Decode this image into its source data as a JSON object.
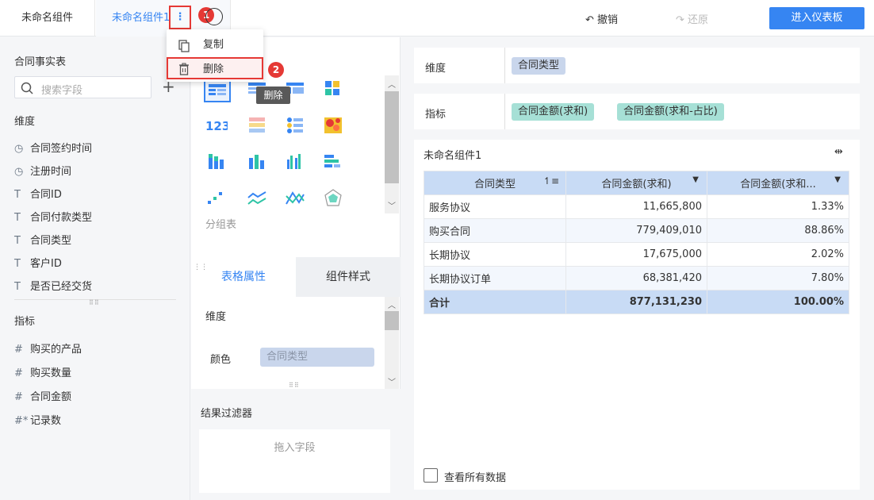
{
  "tabs": [
    {
      "label": "未命名组件"
    },
    {
      "label": "未命名组件1"
    }
  ],
  "header": {
    "undo": "撤销",
    "redo": "还原",
    "enter_dashboard": "进入仪表板"
  },
  "badges": [
    "1",
    "2"
  ],
  "menu": {
    "copy": "复制",
    "delete": "删除"
  },
  "tooltip": "删除",
  "left": {
    "table_name": "合同事实表",
    "search_placeholder": "搜索字段",
    "dimension_title": "维度",
    "dimensions": [
      {
        "icon": "clock-icon",
        "label": "合同签约时间"
      },
      {
        "icon": "clock-icon",
        "label": "注册时间"
      },
      {
        "icon": "text-icon",
        "label": "合同ID"
      },
      {
        "icon": "text-icon",
        "label": "合同付款类型"
      },
      {
        "icon": "text-icon",
        "label": "合同类型"
      },
      {
        "icon": "text-icon",
        "label": "客户ID"
      },
      {
        "icon": "text-icon",
        "label": "是否已经交货"
      }
    ],
    "measure_title": "指标",
    "measures": [
      {
        "icon": "hash-icon",
        "label": "购买的产品"
      },
      {
        "icon": "hash-icon",
        "label": "购买数量"
      },
      {
        "icon": "hash-icon",
        "label": "合同金额"
      },
      {
        "icon": "hash-star-icon",
        "label": "记录数"
      }
    ]
  },
  "middle": {
    "chart_group_label": "分组表",
    "tab_table_props": "表格属性",
    "tab_widget_style": "组件样式",
    "prop_dimension": "维度",
    "prop_color": "颜色",
    "color_field": "合同类型",
    "filter_title": "结果过滤器",
    "drop_hint": "拖入字段"
  },
  "right": {
    "dimension_label": "维度",
    "dimension_pill": "合同类型",
    "measure_label": "指标",
    "measure_pills": [
      "合同金额(求和)",
      "合同金额(求和-占比)"
    ],
    "widget_title": "未命名组件1",
    "columns": [
      "合同类型",
      "合同金额(求和)",
      "合同金额(求和..."
    ],
    "rows": [
      [
        "服务协议",
        "11,665,800",
        "1.33%"
      ],
      [
        "购买合同",
        "779,409,010",
        "88.86%"
      ],
      [
        "长期协议",
        "17,675,000",
        "2.02%"
      ],
      [
        "长期协议订单",
        "68,381,420",
        "7.80%"
      ]
    ],
    "total": [
      "合计",
      "877,131,230",
      "100.00%"
    ],
    "show_all": "查看所有数据"
  }
}
